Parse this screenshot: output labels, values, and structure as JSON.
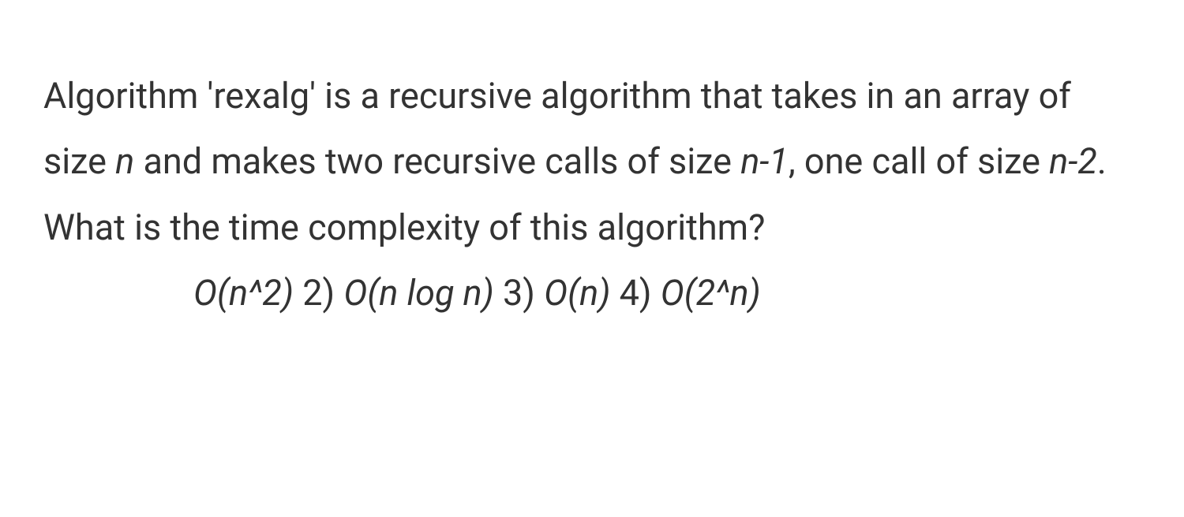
{
  "question": {
    "part1": "Algorithm 'rexalg' is a recursive algorithm that takes in an array of size ",
    "var_n": "n",
    "part2": " and makes two recursive calls of size ",
    "var_n1": "n-1",
    "part3": ", one call of size ",
    "var_n2": "n-2",
    "part4": ". What is the time complexity of this algorithm?"
  },
  "options": {
    "opt1": "O(n^2)",
    "num2": " 2) ",
    "opt2": "O(n log n)",
    "num3": " 3) ",
    "opt3": "O(n)",
    "num4": " 4) ",
    "opt4": "O(2^n)"
  }
}
